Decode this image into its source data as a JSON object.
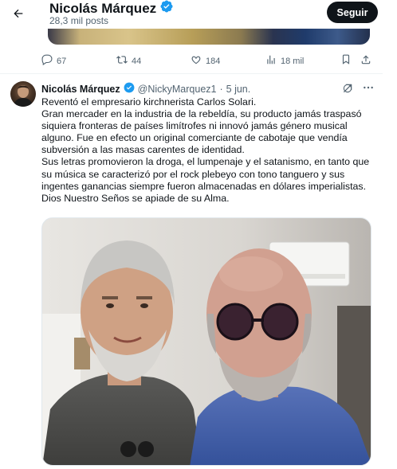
{
  "header": {
    "name": "Nicolás Márquez",
    "posts_count": "28,3 mil posts",
    "follow_label": "Seguir"
  },
  "prev_actions": {
    "replies": "67",
    "reposts": "44",
    "likes": "184",
    "views": "18 mil"
  },
  "tweet": {
    "author_name": "Nicolás Márquez",
    "handle": "@NickyMarquez1",
    "separator": "·",
    "date": "5 jun.",
    "lines": [
      "Reventó el empresario kirchnerista Carlos Solari.",
      "Gran mercader en la industria de la rebeldía, su producto jamás traspasó siquiera fronteras de países limítrofes ni innovó jamás género musical alguno. Fue en efecto un original comerciante de cabotaje que vendía subversión a las masas carentes de identidad.",
      "Sus letras promovieron la droga, el lumpenaje y el satanismo, en tanto que su música se caracterizó por el rock plebeyo con tono tanguero y sus ingentes ganancias siempre fueron almacenadas en dólares imperialistas.",
      "Dios Nuestro Seños se apiade de su Alma."
    ]
  },
  "colors": {
    "verified": "#1d9bf0",
    "text": "#0f1419",
    "secondary": "#536471",
    "follow_bg": "#0f1419"
  },
  "icons": [
    "back-arrow-icon",
    "verified-icon",
    "reply-icon",
    "repost-icon",
    "like-icon",
    "views-icon",
    "bookmark-icon",
    "share-icon",
    "grok-icon",
    "more-icon"
  ]
}
